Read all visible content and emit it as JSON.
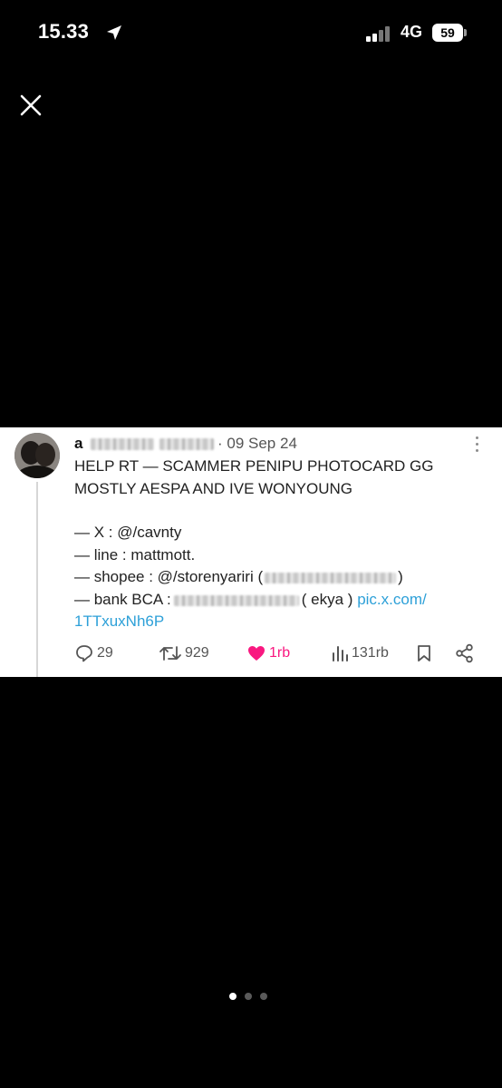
{
  "status_bar": {
    "time": "15.33",
    "network": "4G",
    "battery": "59"
  },
  "viewer": {
    "close_icon": "close-icon",
    "page_count": 3,
    "active_page": 1
  },
  "tweet": {
    "name_initial": "a",
    "date": "· 09 Sep 24",
    "line1": "HELP RT — SCAMMER PENIPU PHOTOCARD GG",
    "line2": "MOSTLY AESPA AND IVE WONYOUNG",
    "x_line": "— X : @/cavnty",
    "line_line": "— line : mattmott.",
    "shopee_prefix": "— shopee : @/storenyariri (",
    "shopee_suffix": ")",
    "bank_prefix": "— bank BCA :",
    "bank_suffix": "( ekya )",
    "link_part1": "pic.x.com/",
    "link_part2": "1TTxuxNh6P",
    "replies": "29",
    "reposts": "929",
    "likes": "1rb",
    "views": "131rb",
    "like_color": "#f91880",
    "link_color": "#2da0d8"
  }
}
